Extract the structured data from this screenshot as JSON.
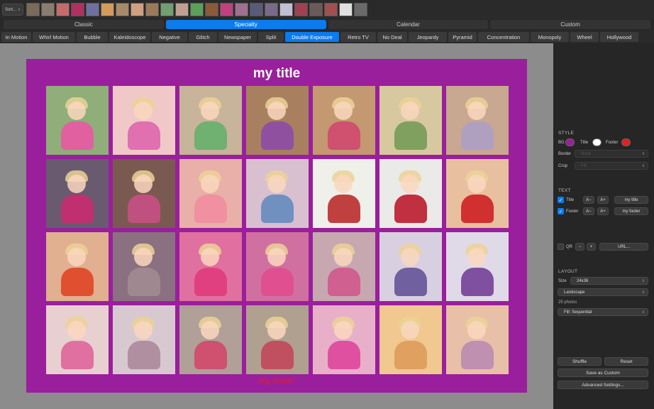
{
  "toolbar": {
    "sort_label": "Sort..."
  },
  "thumbnails": [
    {
      "bg": "#7a6a5a"
    },
    {
      "bg": "#8a7c70"
    },
    {
      "bg": "#c86a6a"
    },
    {
      "bg": "#b03060"
    },
    {
      "bg": "#7070a0"
    },
    {
      "bg": "#d49a5a"
    },
    {
      "bg": "#a88a6a"
    },
    {
      "bg": "#d0a080"
    },
    {
      "bg": "#9a7a5a"
    },
    {
      "bg": "#70a070"
    },
    {
      "bg": "#c0a090"
    },
    {
      "bg": "#5aa05a"
    },
    {
      "bg": "#8a5a3a"
    },
    {
      "bg": "#c04080"
    },
    {
      "bg": "#a07090"
    },
    {
      "bg": "#5a5a7a"
    },
    {
      "bg": "#7a6a8a"
    },
    {
      "bg": "#c0c0d0"
    },
    {
      "bg": "#a04050"
    },
    {
      "bg": "#6a5a5a"
    },
    {
      "bg": "#a05050"
    },
    {
      "bg": "#e0e0e0"
    },
    {
      "bg": "#6a6a6a"
    }
  ],
  "modes": [
    {
      "label": "Classic",
      "active": false
    },
    {
      "label": "Specialty",
      "active": true
    },
    {
      "label": "Calendar",
      "active": false
    },
    {
      "label": "Custom",
      "active": false
    }
  ],
  "effects": [
    {
      "label": "In Motion",
      "w": 42,
      "active": false
    },
    {
      "label": "Whirl Motion",
      "w": 60,
      "active": false
    },
    {
      "label": "Bubble",
      "w": 44,
      "active": false
    },
    {
      "label": "Kaleidoscope",
      "w": 58,
      "active": false
    },
    {
      "label": "Negative",
      "w": 50,
      "active": false
    },
    {
      "label": "Glitch",
      "w": 40,
      "active": false
    },
    {
      "label": "Newspaper",
      "w": 54,
      "active": false
    },
    {
      "label": "Split",
      "w": 36,
      "active": false
    },
    {
      "label": "Double Exposure",
      "w": 76,
      "active": true
    },
    {
      "label": "Retro TV",
      "w": 50,
      "active": false
    },
    {
      "label": "No Deal",
      "w": 42,
      "active": false
    },
    {
      "label": "Jeopardy",
      "w": 54,
      "active": false
    },
    {
      "label": "Pyramid",
      "w": 40,
      "active": false
    },
    {
      "label": "Concentration",
      "w": 72,
      "active": false
    },
    {
      "label": "Monopoly",
      "w": 54,
      "active": false
    },
    {
      "label": "Wheel",
      "w": 40,
      "active": false
    },
    {
      "label": "Hollywood",
      "w": 54,
      "active": false
    }
  ],
  "poster": {
    "title": "my title",
    "footer": "my footer",
    "photos": [
      {
        "bg": "#8fae7a",
        "body": "#e060a0"
      },
      {
        "bg": "#f0c8c8",
        "body": "#e070b0"
      },
      {
        "bg": "#c8b49a",
        "body": "#70b070"
      },
      {
        "bg": "#a88060",
        "body": "#9050a0"
      },
      {
        "bg": "#c49870",
        "body": "#d05070"
      },
      {
        "bg": "#d8c8a0",
        "body": "#80a060"
      },
      {
        "bg": "#c8a890",
        "body": "#b0a0c0"
      },
      {
        "bg": "#6a5a70",
        "body": "#c03070"
      },
      {
        "bg": "#7a5a50",
        "body": "#c05080"
      },
      {
        "bg": "#e8b0a8",
        "body": "#f090a0"
      },
      {
        "bg": "#d8c0d0",
        "body": "#7090c0"
      },
      {
        "bg": "#f0f0ea",
        "body": "#c04040"
      },
      {
        "bg": "#eaeae8",
        "body": "#c03040"
      },
      {
        "bg": "#e8c0a0",
        "body": "#d03030"
      },
      {
        "bg": "#e0b090",
        "body": "#e05030"
      },
      {
        "bg": "#8a7080",
        "body": "#a08890"
      },
      {
        "bg": "#e070a0",
        "body": "#e04080"
      },
      {
        "bg": "#d070a0",
        "body": "#e05090"
      },
      {
        "bg": "#c8a8b0",
        "body": "#d06090"
      },
      {
        "bg": "#d8d0e0",
        "body": "#7060a0"
      },
      {
        "bg": "#e0dae8",
        "body": "#8050a0"
      },
      {
        "bg": "#e8d0d0",
        "body": "#e070a0"
      },
      {
        "bg": "#d8c8d0",
        "body": "#b090a0"
      },
      {
        "bg": "#b0a098",
        "body": "#d05070"
      },
      {
        "bg": "#b0a090",
        "body": "#c05060"
      },
      {
        "bg": "#e8b0c8",
        "body": "#e050a0"
      },
      {
        "bg": "#f0c890",
        "body": "#e0a060"
      },
      {
        "bg": "#e8c0a8",
        "body": "#c090b0"
      }
    ]
  },
  "panel": {
    "style_heading": "STYLE",
    "bg_label": "BG",
    "title_label": "Title",
    "footer_label": "Footer",
    "bg_color": "#9a1f9c",
    "title_color": "#ffffff",
    "footer_color": "#e32020",
    "border_label": "Border",
    "border_value": "None",
    "crop_label": "Crop",
    "crop_value": "Fill",
    "text_heading": "TEXT",
    "text_title_label": "Title",
    "text_footer_label": "Footer",
    "decrease_label": "A−",
    "increase_label": "A+",
    "title_value": "my title",
    "footer_value": "my footer",
    "qr_label": "QR",
    "minus_label": "−",
    "plus_label": "+",
    "url_label": "URL...",
    "layout_heading": "LAYOUT",
    "size_label": "Size",
    "size_value": "24x36",
    "orientation_value": "Landscape",
    "photo_count": "25 photos",
    "fill_value": "Fill: Sequential",
    "shuffle_label": "Shuffle",
    "reset_label": "Reset",
    "save_custom_label": "Save as Custom",
    "advanced_label": "Advanced Settings..."
  }
}
